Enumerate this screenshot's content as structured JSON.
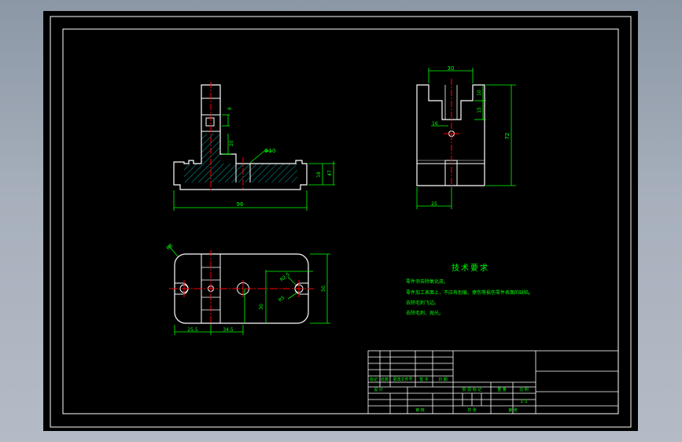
{
  "colors": {
    "background": "#000000",
    "outline": "#ffffff",
    "dimension": "#00ff00",
    "centerline": "#ff0000",
    "hatch": "#00a0a0",
    "text": "#00ff00"
  },
  "front_view": {
    "dims": {
      "overall_width": "96",
      "base_height": "18",
      "overall_height": "47",
      "slot_w": "8",
      "pin_height": "20",
      "hole": "Φ10"
    }
  },
  "side_view": {
    "dims": {
      "top_width": "30",
      "overall_height": "72",
      "top_step1": "10",
      "top_step2": "15",
      "offset": "16",
      "bottom_width": "25"
    }
  },
  "top_view": {
    "dims": {
      "corner_radius": "R8",
      "slot_r": "R2.5",
      "slot_r2": "R5",
      "width": "50",
      "hole_pos": "30",
      "left": "25.5",
      "center": "34.5"
    }
  },
  "tech_requirements": {
    "title": "技术要求",
    "lines": [
      "零件须去除氧化皮。",
      "零件加工表面上，不应有划痕、擦伤等损伤零件表面的缺陷。",
      "去除毛刺飞边。",
      "去除毛刺，抛光。"
    ]
  },
  "title_block": {
    "row_a": [
      "标记",
      "处数",
      "更改文件号",
      "签 字",
      "日 期"
    ],
    "row_b": [
      "设 计"
    ],
    "stage_labels": [
      "阶 段 标 记",
      "重 量",
      "比 例"
    ],
    "scale": "1:1",
    "approve": "审 核",
    "process": "工 艺",
    "sheets_a": "共    张",
    "sheets_b": "第    张"
  }
}
